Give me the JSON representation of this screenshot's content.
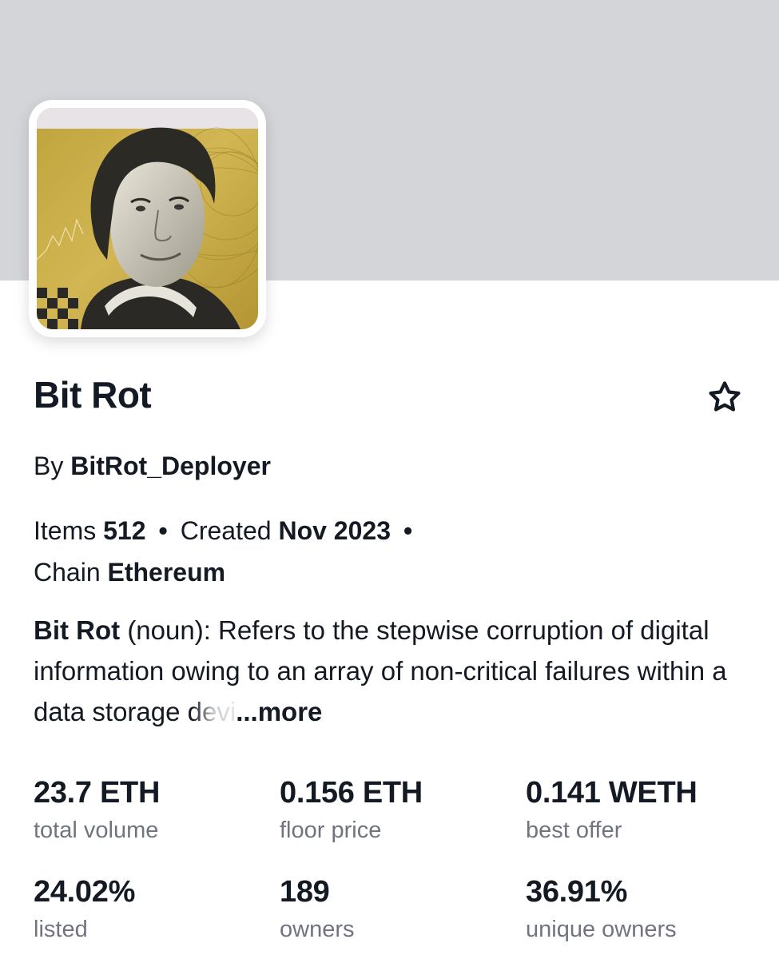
{
  "collection": {
    "name": "Bit Rot",
    "by_prefix": "By",
    "creator": "BitRot_Deployer"
  },
  "meta": {
    "items_label": "Items",
    "items_value": "512",
    "created_label": "Created",
    "created_value": "Nov 2023",
    "chain_label": "Chain",
    "chain_value": "Ethereum",
    "separator": "•"
  },
  "description": {
    "term": "Bit Rot",
    "text": "(noun): Refers to the stepwise corruption of digital information owing to an array of non-critical failures within a data storage",
    "faded_text": "devi",
    "more_label": "...more"
  },
  "stats": [
    {
      "value": "23.7 ETH",
      "label": "total volume"
    },
    {
      "value": "0.156 ETH",
      "label": "floor price"
    },
    {
      "value": "0.141 WETH",
      "label": "best offer"
    },
    {
      "value": "24.02%",
      "label": "listed"
    },
    {
      "value": "189",
      "label": "owners"
    },
    {
      "value": "36.91%",
      "label": "unique owners"
    }
  ],
  "colors": {
    "banner": "#d4d5d9",
    "text": "#141a24",
    "muted": "#6f7480",
    "avatar_bg": "#c8aa45"
  },
  "icons": {
    "favorite": "star-outline-icon"
  }
}
